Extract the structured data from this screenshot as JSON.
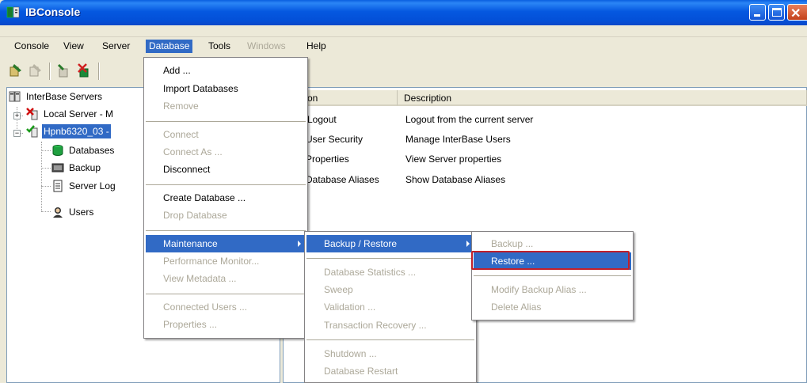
{
  "window": {
    "title": "IBConsole",
    "accent": "#316ac5",
    "titlebar_color": "#0558e0"
  },
  "menubar": {
    "items": [
      {
        "label": "Console",
        "state": "normal"
      },
      {
        "label": "View",
        "state": "normal"
      },
      {
        "label": "Server",
        "state": "normal"
      },
      {
        "label": "Database",
        "state": "active"
      },
      {
        "label": "Tools",
        "state": "normal"
      },
      {
        "label": "Windows",
        "state": "disabled"
      },
      {
        "label": "Help",
        "state": "normal"
      }
    ]
  },
  "toolbar": {
    "icons": [
      "server-login-icon",
      "server-logout-icon",
      "database-connect-icon",
      "database-disconnect-icon"
    ]
  },
  "tree": {
    "root": "InterBase Servers",
    "local_server": "Local Server - M",
    "server": "Hpnb6320_03 -",
    "children": [
      "Databases",
      "Backup",
      "Server Log",
      "Users"
    ]
  },
  "list": {
    "headers": {
      "action": "on",
      "description": "Description"
    },
    "rows": [
      {
        "action": "Logout",
        "description": "Logout from the current server"
      },
      {
        "action": "User Security",
        "description": "Manage InterBase Users"
      },
      {
        "action": "Properties",
        "description": "View Server properties"
      },
      {
        "action": "Database Aliases",
        "description": "Show Database Aliases"
      }
    ]
  },
  "database_menu": {
    "add": "Add ...",
    "import": "Import Databases",
    "remove": "Remove",
    "connect": "Connect",
    "connect_as": "Connect As ...",
    "disconnect": "Disconnect",
    "create": "Create Database ...",
    "drop": "Drop Database",
    "maintenance": "Maintenance",
    "perf_monitor": "Performance Monitor...",
    "view_metadata": "View Metadata ...",
    "connected_users": "Connected Users ...",
    "properties": "Properties ..."
  },
  "maintenance_menu": {
    "backup_restore": "Backup / Restore",
    "db_stats": "Database Statistics ...",
    "sweep": "Sweep",
    "validation": "Validation ...",
    "tx_recovery": "Transaction Recovery ...",
    "shutdown": "Shutdown ...",
    "db_restart": "Database Restart"
  },
  "backup_menu": {
    "backup": "Backup ...",
    "restore": "Restore ...",
    "modify_alias": "Modify Backup Alias ...",
    "delete_alias": "Delete Alias"
  }
}
